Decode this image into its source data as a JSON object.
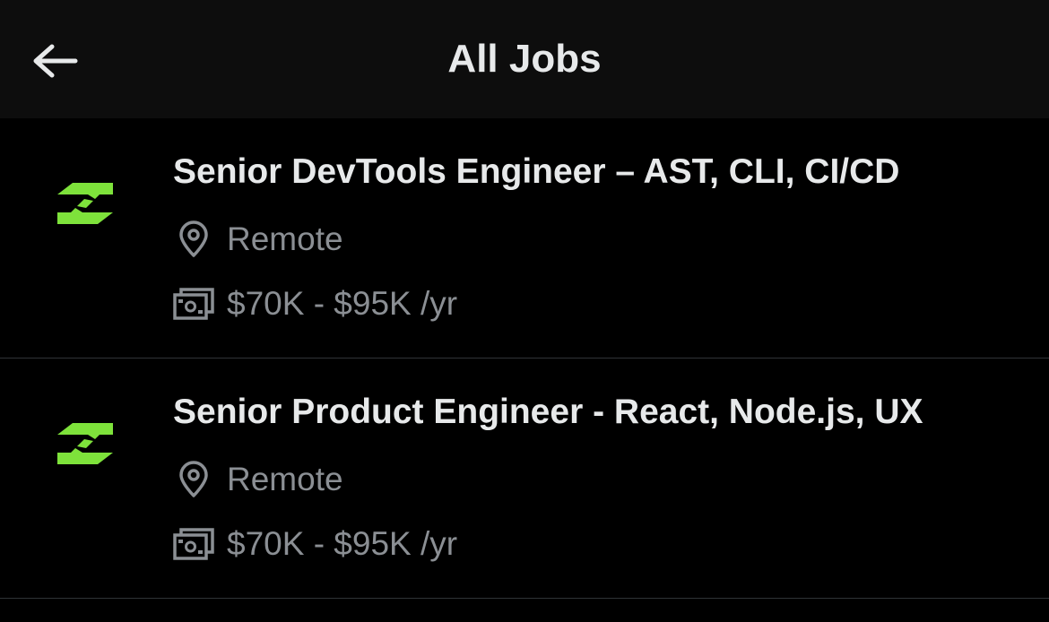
{
  "header": {
    "title": "All Jobs",
    "back_icon": "arrow-left-icon"
  },
  "colors": {
    "background": "#000000",
    "header_bg": "#0d0d0d",
    "brand_green": "#7ee23b",
    "text_primary": "#e7e9ea",
    "text_secondary": "#8b8f94",
    "divider": "#2f3336"
  },
  "jobs": [
    {
      "title": "Senior DevTools Engineer – AST, CLI, CI/CD",
      "location": "Remote",
      "salary": "$70K - $95K /yr",
      "logo_icon": "company-logo-icon",
      "location_icon": "map-pin-icon",
      "salary_icon": "money-icon"
    },
    {
      "title": "Senior Product Engineer - React, Node.js, UX",
      "location": "Remote",
      "salary": "$70K - $95K /yr",
      "logo_icon": "company-logo-icon",
      "location_icon": "map-pin-icon",
      "salary_icon": "money-icon"
    }
  ]
}
